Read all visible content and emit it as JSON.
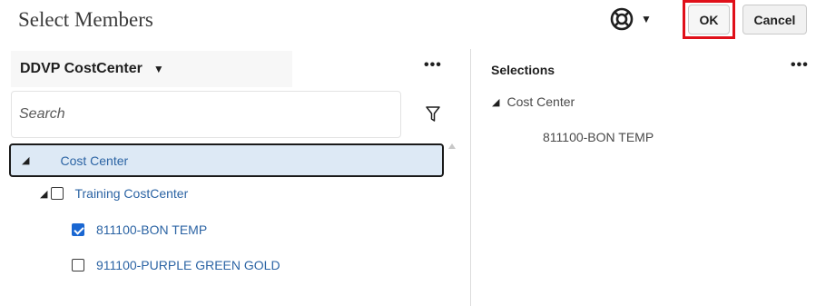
{
  "dialog": {
    "title": "Select Members"
  },
  "toolbar": {
    "help_icon": "lifebuoy-icon",
    "ok_label": "OK",
    "cancel_label": "Cancel",
    "highlight_color": "#e0101a"
  },
  "left_panel": {
    "dimension_label": "DDVP CostCenter",
    "more_label": "•••",
    "search_placeholder": "Search",
    "tree": [
      {
        "label": "Cost Center",
        "expanded": true,
        "selected": true
      },
      {
        "label": "Training CostCenter",
        "expanded": true,
        "checked": false
      },
      {
        "label": "811100-BON TEMP",
        "checked": true
      },
      {
        "label": "911100-PURPLE GREEN GOLD",
        "checked": false
      }
    ]
  },
  "right_panel": {
    "title": "Selections",
    "more_label": "•••",
    "tree": [
      {
        "label": "Cost Center",
        "expanded": true
      },
      {
        "label": "811100-BON TEMP"
      }
    ]
  },
  "colors": {
    "link_blue": "#2c64a4",
    "selected_row_bg": "#dde9f5",
    "checkbox_blue": "#1a67d2"
  }
}
